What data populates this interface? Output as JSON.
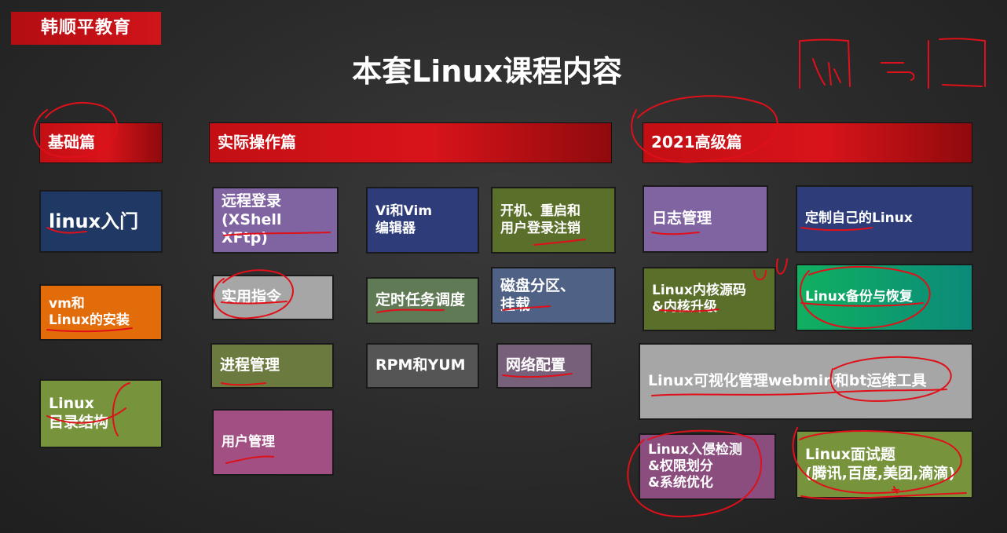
{
  "brand": "韩顺平教育",
  "title": "本套Linux课程内容",
  "sections": {
    "basic": "基础篇",
    "practical": "实际操作篇",
    "advanced": "2021高级篇"
  },
  "basic_items": [
    {
      "lines": [
        "linux入门"
      ],
      "color": "#1f3864"
    },
    {
      "lines": [
        "vm和",
        "Linux的安装"
      ],
      "color": "#e36c0a"
    },
    {
      "lines": [
        "Linux",
        "目录结构"
      ],
      "color": "#77933c"
    }
  ],
  "practical_items": [
    {
      "lines": [
        "远程登录",
        "(XShell XFtp)"
      ],
      "color": "#8064a2"
    },
    {
      "lines": [
        "实用指令"
      ],
      "color": "#a6a6a6"
    },
    {
      "lines": [
        "进程管理"
      ],
      "color": "#6b7a3f"
    },
    {
      "lines": [
        "用户管理"
      ],
      "color": "#a24f84"
    },
    {
      "lines": [
        "Vi和Vim",
        "编辑器"
      ],
      "color": "#2e3d7a"
    },
    {
      "lines": [
        "定时任务调度"
      ],
      "color": "#5f7a55"
    },
    {
      "lines": [
        "RPM和YUM"
      ],
      "color": "#555555"
    },
    {
      "lines": [
        "开机、重启和",
        "用户登录注销"
      ],
      "color": "#5a6f2a"
    },
    {
      "lines": [
        "磁盘分区、",
        "挂载"
      ],
      "color": "#4f6184"
    },
    {
      "lines": [
        "网络配置"
      ],
      "color": "#77607a"
    }
  ],
  "advanced_items": [
    {
      "lines": [
        "日志管理"
      ],
      "color": "#8064a2"
    },
    {
      "lines": [
        "定制自己的Linux"
      ],
      "color": "#2e3d7a"
    },
    {
      "lines": [
        "Linux内核源码",
        "&内核升级"
      ],
      "color": "#5a6f2a"
    },
    {
      "lines": [
        "Linux备份与恢复"
      ],
      "color": "#10a060"
    },
    {
      "lines": [
        "Linux可视化管理webmin和bt运维工具"
      ],
      "color": "#a6a6a6"
    },
    {
      "lines": [
        "Linux入侵检测",
        "&权限划分",
        "&系统优化"
      ],
      "color": "#8a4d7e"
    },
    {
      "lines": [
        "Linux面试题",
        "(腾讯,百度,美团,滴滴)"
      ],
      "color": "#77933c"
    }
  ]
}
